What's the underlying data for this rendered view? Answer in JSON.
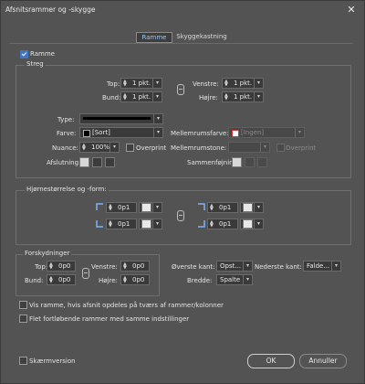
{
  "window": {
    "title": "Afsnitsrammer og -skygge",
    "close_label": "✕"
  },
  "tabs": [
    {
      "label": "Ramme",
      "selected": true
    },
    {
      "label": "Skyggekastning",
      "selected": false
    }
  ],
  "frame": {
    "label": "Ramme",
    "checked": true
  },
  "stroke": {
    "legend": "Streg",
    "top_label": "Top:",
    "top_value": "1 pkt.",
    "bottom_label": "Bund:",
    "bottom_value": "1 pkt.",
    "left_label": "Venstre:",
    "left_value": "1 pkt.",
    "right_label": "Højre:",
    "right_value": "1 pkt.",
    "type_label": "Type:",
    "color_label": "Farve:",
    "color_value": "[Sort]",
    "tint_label": "Nuance:",
    "tint_value": "100%",
    "overprint_label": "Overprint",
    "gap_color_label": "Mellemrumsfarve:",
    "gap_color_value": "[Ingen]",
    "gap_tint_label": "Mellemrumstone:",
    "gap_overprint_label": "Overprint",
    "cap_label": "Afslutning:",
    "join_label": "Sammenføjning:"
  },
  "corners": {
    "legend": "Hjørnestørrelse og -form:",
    "tl": "0p1",
    "tr": "0p1",
    "bl": "0p1",
    "br": "0p1"
  },
  "offsets": {
    "legend": "Forskydninger",
    "top_label": "Top:",
    "top_value": "0p0",
    "bottom_label": "Bund:",
    "bottom_value": "0p0",
    "left_label": "Venstre:",
    "left_value": "0p0",
    "right_label": "Højre:",
    "right_value": "0p0",
    "top_edge_label": "Øverste kant:",
    "top_edge_value": "Opst...",
    "bottom_edge_label": "Nederste kant:",
    "bottom_edge_value": "Falde...",
    "width_label": "Bredde:",
    "width_value": "Spalte"
  },
  "options": {
    "show_frame_label": "Vis ramme, hvis afsnit opdeles på tværs af rammer/kolonner",
    "merge_label": "Flet fortløbende rammer med samme indstillinger"
  },
  "footer": {
    "preview_label": "Skærmversion",
    "ok_label": "OK",
    "cancel_label": "Annuller"
  },
  "colors": {
    "accent": "#3d75c4",
    "tab_text": "#9fc7f4",
    "background": "#535353"
  }
}
